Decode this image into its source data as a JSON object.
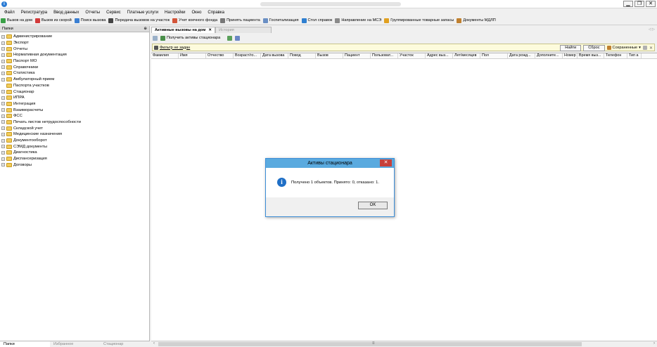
{
  "app": {
    "window_controls": {
      "minimize": "▁",
      "maximize": "❐",
      "close": "✕"
    },
    "app_icon_glyph": "i"
  },
  "menu": [
    "Файл",
    "Регистратура",
    "Ввод данных",
    "Отчеты",
    "Сервис",
    "Платные услуги",
    "Настройки",
    "Окно",
    "Справка"
  ],
  "toolbar": [
    {
      "label": "Вызов на дом",
      "icon": "home-call-icon",
      "color": "#3aa047"
    },
    {
      "label": "Вызов из скорой",
      "icon": "ambulance-icon",
      "color": "#d23a3a"
    },
    {
      "label": "Поиск вызова",
      "icon": "search-icon",
      "color": "#3a7fd2"
    },
    {
      "label": "Передача вызовов на участок",
      "icon": "transfer-icon",
      "color": "#444444"
    },
    {
      "label": "Учет коечного фонда",
      "icon": "bed-icon",
      "color": "#d2553a"
    },
    {
      "label": "Принять пациента",
      "icon": "accept-patient-icon",
      "color": "#777777"
    },
    {
      "label": "Госпитализация",
      "icon": "hospital-icon",
      "color": "#6a8fc4"
    },
    {
      "label": "Стол справок",
      "icon": "globe-icon",
      "color": "#2f7fd0"
    },
    {
      "label": "Направление на МСЭ",
      "icon": "referral-icon",
      "color": "#8a8a8a"
    },
    {
      "label": "Группированные товарные запасы",
      "icon": "stock-icon",
      "color": "#e0a020"
    },
    {
      "label": "Документы МДЛП",
      "icon": "documents-icon",
      "color": "#c08030"
    }
  ],
  "left_panel": {
    "header": "Папки",
    "pin": "⊕",
    "tree": [
      {
        "label": "Администрирование",
        "expand": "+"
      },
      {
        "label": "Экспорт",
        "expand": "+"
      },
      {
        "label": "Отчеты",
        "expand": "+"
      },
      {
        "label": "Нормативная документация",
        "expand": "+"
      },
      {
        "label": "Паспорт МО",
        "expand": "+"
      },
      {
        "label": "Справочники",
        "expand": "+"
      },
      {
        "label": "Статистика",
        "expand": "+"
      },
      {
        "label": "Амбулаторный прием",
        "expand": "+"
      },
      {
        "label": "Паспорта участков",
        "expand": ""
      },
      {
        "label": "Стационар",
        "expand": "+"
      },
      {
        "label": "ИПРА",
        "expand": "+"
      },
      {
        "label": "Интеграция",
        "expand": "+"
      },
      {
        "label": "Взаиморасчеты",
        "expand": "+"
      },
      {
        "label": "ФСС",
        "expand": "+"
      },
      {
        "label": "Печать листов нетрудоспособности",
        "expand": "+"
      },
      {
        "label": "Складской учет",
        "expand": "+"
      },
      {
        "label": "Медицинские назначения",
        "expand": "+"
      },
      {
        "label": "Документооборот",
        "expand": "+"
      },
      {
        "label": "СЭМД документы",
        "expand": "+"
      },
      {
        "label": "Диагностика",
        "expand": "+"
      },
      {
        "label": "Диспансеризация",
        "expand": "+"
      },
      {
        "label": "Договоры",
        "expand": "+"
      }
    ],
    "bottom_tabs": [
      "Папки",
      "Избранное",
      "Стационар"
    ]
  },
  "main": {
    "tabs": [
      {
        "label": "Активные вызовы на дом",
        "close": "✕"
      },
      {
        "label": "История"
      }
    ],
    "tabs_nav": "◁ ▷",
    "get_button": "Получить активы стационара",
    "filter_text": "Фильтр не задан",
    "find_button": "Найти",
    "reset_button": "Сброс",
    "saved_label": "Сохраненные",
    "columns": [
      "Фамилия",
      "Имя",
      "Отчество",
      "Возраст/го...",
      "Дата вызова",
      "Повод",
      "Вызов",
      "Пациент",
      "Пользоват...",
      "Участок",
      "Адрес выз...",
      "Лет/месяцев",
      "Пол",
      "Дата рожд...",
      "Дополните...",
      "Номер",
      "Время выз...",
      "Телефон",
      "Тип а"
    ],
    "scroll_grip": "≡"
  },
  "dialog": {
    "title": "Активы стационара",
    "close": "✕",
    "message": "Получено 1 объектов. Принято: 0, отказано: 1.",
    "ok": "OK",
    "icon_glyph": "i"
  }
}
